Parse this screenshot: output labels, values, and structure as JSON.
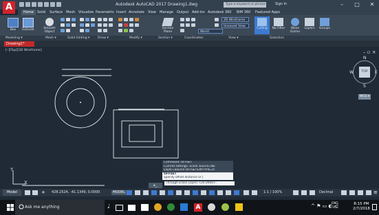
{
  "app": {
    "title": "Autodesk AutoCAD 2017   Drawing1.dwg",
    "search_placeholder": "Type a keyword or phrase",
    "sign_in": "Sign In",
    "window_controls": [
      "–",
      "□",
      "✕"
    ]
  },
  "ribbon": {
    "tabs": [
      "Home",
      "Solid",
      "Surface",
      "Mesh",
      "Visualize",
      "Parametric",
      "Insert",
      "Annotate",
      "View",
      "Manage",
      "Output",
      "Add-ins",
      "Autodesk 360",
      "BIM 360",
      "Featured Apps"
    ],
    "active_tab": "Home",
    "buttons": {
      "box": "Box",
      "extrude": "Extrude",
      "smooth_object": "Smooth Object",
      "section_plane": "Section Plane",
      "culling": "Culling",
      "no_filter": "No Filter",
      "move_gizmo": "Move Gizmo",
      "layers": "Layers",
      "groups": "Groups"
    },
    "dropdowns": {
      "visual_style": "2D Wireframe",
      "saved_view": "Unsaved View",
      "coordinate": "World"
    },
    "panels": [
      "Modeling ▾",
      "Mesh ▾",
      "Solid Editing ▾",
      "Draw ▾",
      "Modify ▾",
      "Section ▾",
      "Coordinates",
      "View ▾",
      "Selection"
    ]
  },
  "document": {
    "tab": "Drawing1*",
    "viewport_label": "[–][Top][2D Wireframe]"
  },
  "viewcube": {
    "top": "TOP",
    "north": "N",
    "south": "S",
    "east": "E",
    "west": "W",
    "wcs": "WCS ▾"
  },
  "viewport_controls": "– ▫ ×",
  "ucs": {
    "x": "X",
    "y": "Y"
  },
  "command": {
    "history": [
      "Command: OFFSET",
      "Current settings: Erase source=No",
      "Layer=Source  OFFSETGAPTYPE=0"
    ],
    "active": "OFFSET",
    "prompt": "Specify offset distance or [",
    "prompt2": "Through Erase Layer] <20.0000>:"
  },
  "status": {
    "model_tab": "Model",
    "coordinates": "428.2524, -41.1349, 0.0000",
    "model_button": "MODEL",
    "scale": "1:1 / 100%",
    "units": "Decimal"
  },
  "taskbar": {
    "search": "Ask me anything",
    "lang": "ENG",
    "region": "US",
    "time": "8:15 PM",
    "date": "2/7/2018"
  }
}
